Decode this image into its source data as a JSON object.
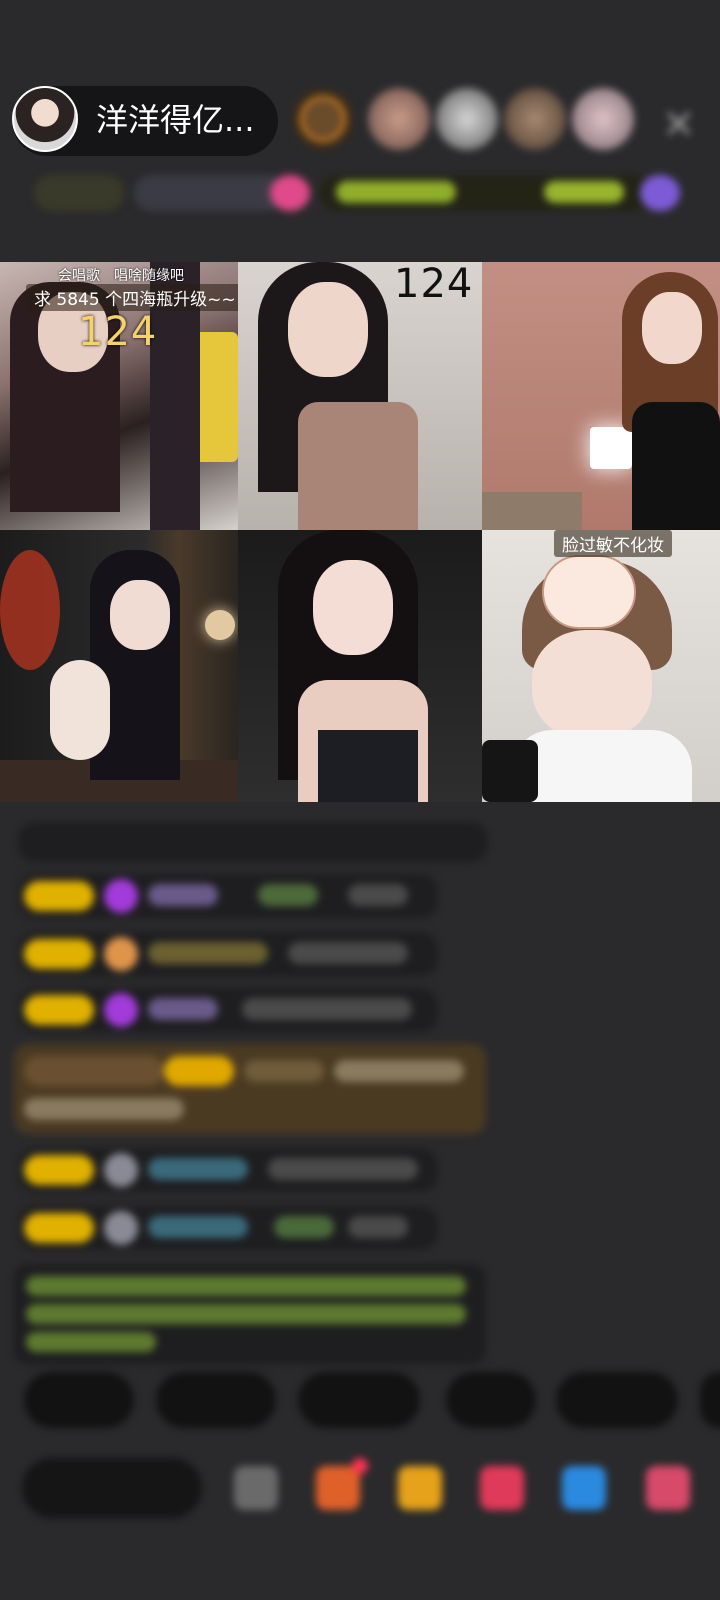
{
  "host": {
    "name": "洋洋得亿..."
  },
  "close_icon": "✕",
  "tiles": [
    {
      "tag_line1": "会唱歌　唱啥随缘吧",
      "tag_line2": "求 5845 个四海瓶升级~~",
      "count": "124"
    },
    {
      "count": "124"
    },
    {},
    {},
    {},
    {
      "tag": "脸过敏不化妆"
    }
  ]
}
